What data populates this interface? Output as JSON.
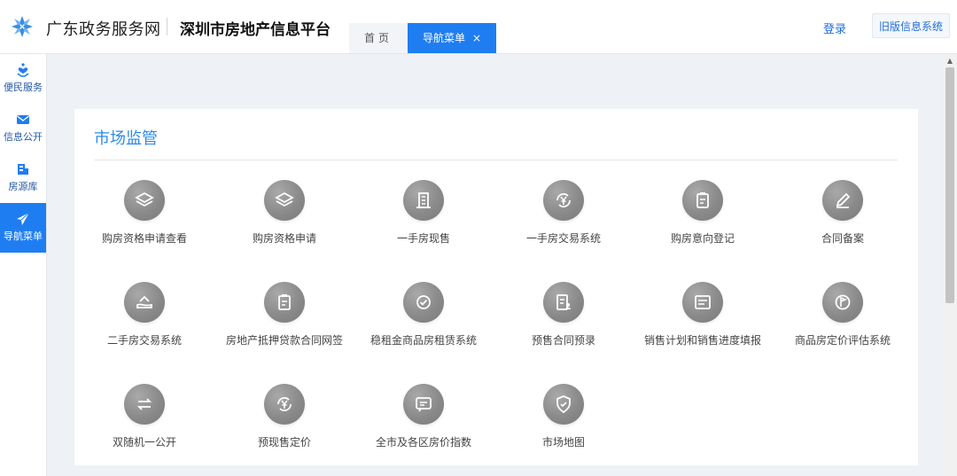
{
  "header": {
    "brand": "广东政务服务网",
    "platform": "深圳市房地产信息平台",
    "tabs": {
      "home": "首页",
      "nav": "导航菜单",
      "close": "×"
    },
    "login": "登录",
    "old_system": "旧版信息系统"
  },
  "sidebar": {
    "items": [
      {
        "label": "便民服务",
        "icon": "heart-hand-icon"
      },
      {
        "label": "信息公开",
        "icon": "mail-icon"
      },
      {
        "label": "房源库",
        "icon": "building-icon"
      },
      {
        "label": "导航菜单",
        "icon": "paper-plane-icon",
        "active": true
      }
    ]
  },
  "panel": {
    "title": "市场监管",
    "tiles": [
      {
        "label": "购房资格申请查看",
        "icon": "layers-icon"
      },
      {
        "label": "购房资格申请",
        "icon": "layers-icon"
      },
      {
        "label": "一手房现售",
        "icon": "building-icon"
      },
      {
        "label": "一手房交易系统",
        "icon": "yen-cycle-icon"
      },
      {
        "label": "购房意向登记",
        "icon": "clipboard-icon"
      },
      {
        "label": "合同备案",
        "icon": "pencil-icon"
      },
      {
        "label": "二手房交易系统",
        "icon": "house-hand-icon"
      },
      {
        "label": "房地产抵押贷款合同网签",
        "icon": "clipboard-icon"
      },
      {
        "label": "稳租金商品房租赁系统",
        "icon": "check-cycle-icon"
      },
      {
        "label": "预售合同预录",
        "icon": "document-person-icon"
      },
      {
        "label": "销售计划和销售进度填报",
        "icon": "form-icon"
      },
      {
        "label": "商品房定价评估系统",
        "icon": "flag-circle-icon"
      },
      {
        "label": "双随机一公开",
        "icon": "swap-arrows-icon"
      },
      {
        "label": "预现售定价",
        "icon": "yen-cycle-icon"
      },
      {
        "label": "全市及各区房价指数",
        "icon": "message-icon"
      },
      {
        "label": "市场地图",
        "icon": "shield-icon"
      }
    ]
  },
  "colors": {
    "accent": "#1f7df2",
    "title_blue": "#2e8ae6",
    "icon_gray": "#8a8a8a",
    "page_bg": "#eef1f5"
  }
}
